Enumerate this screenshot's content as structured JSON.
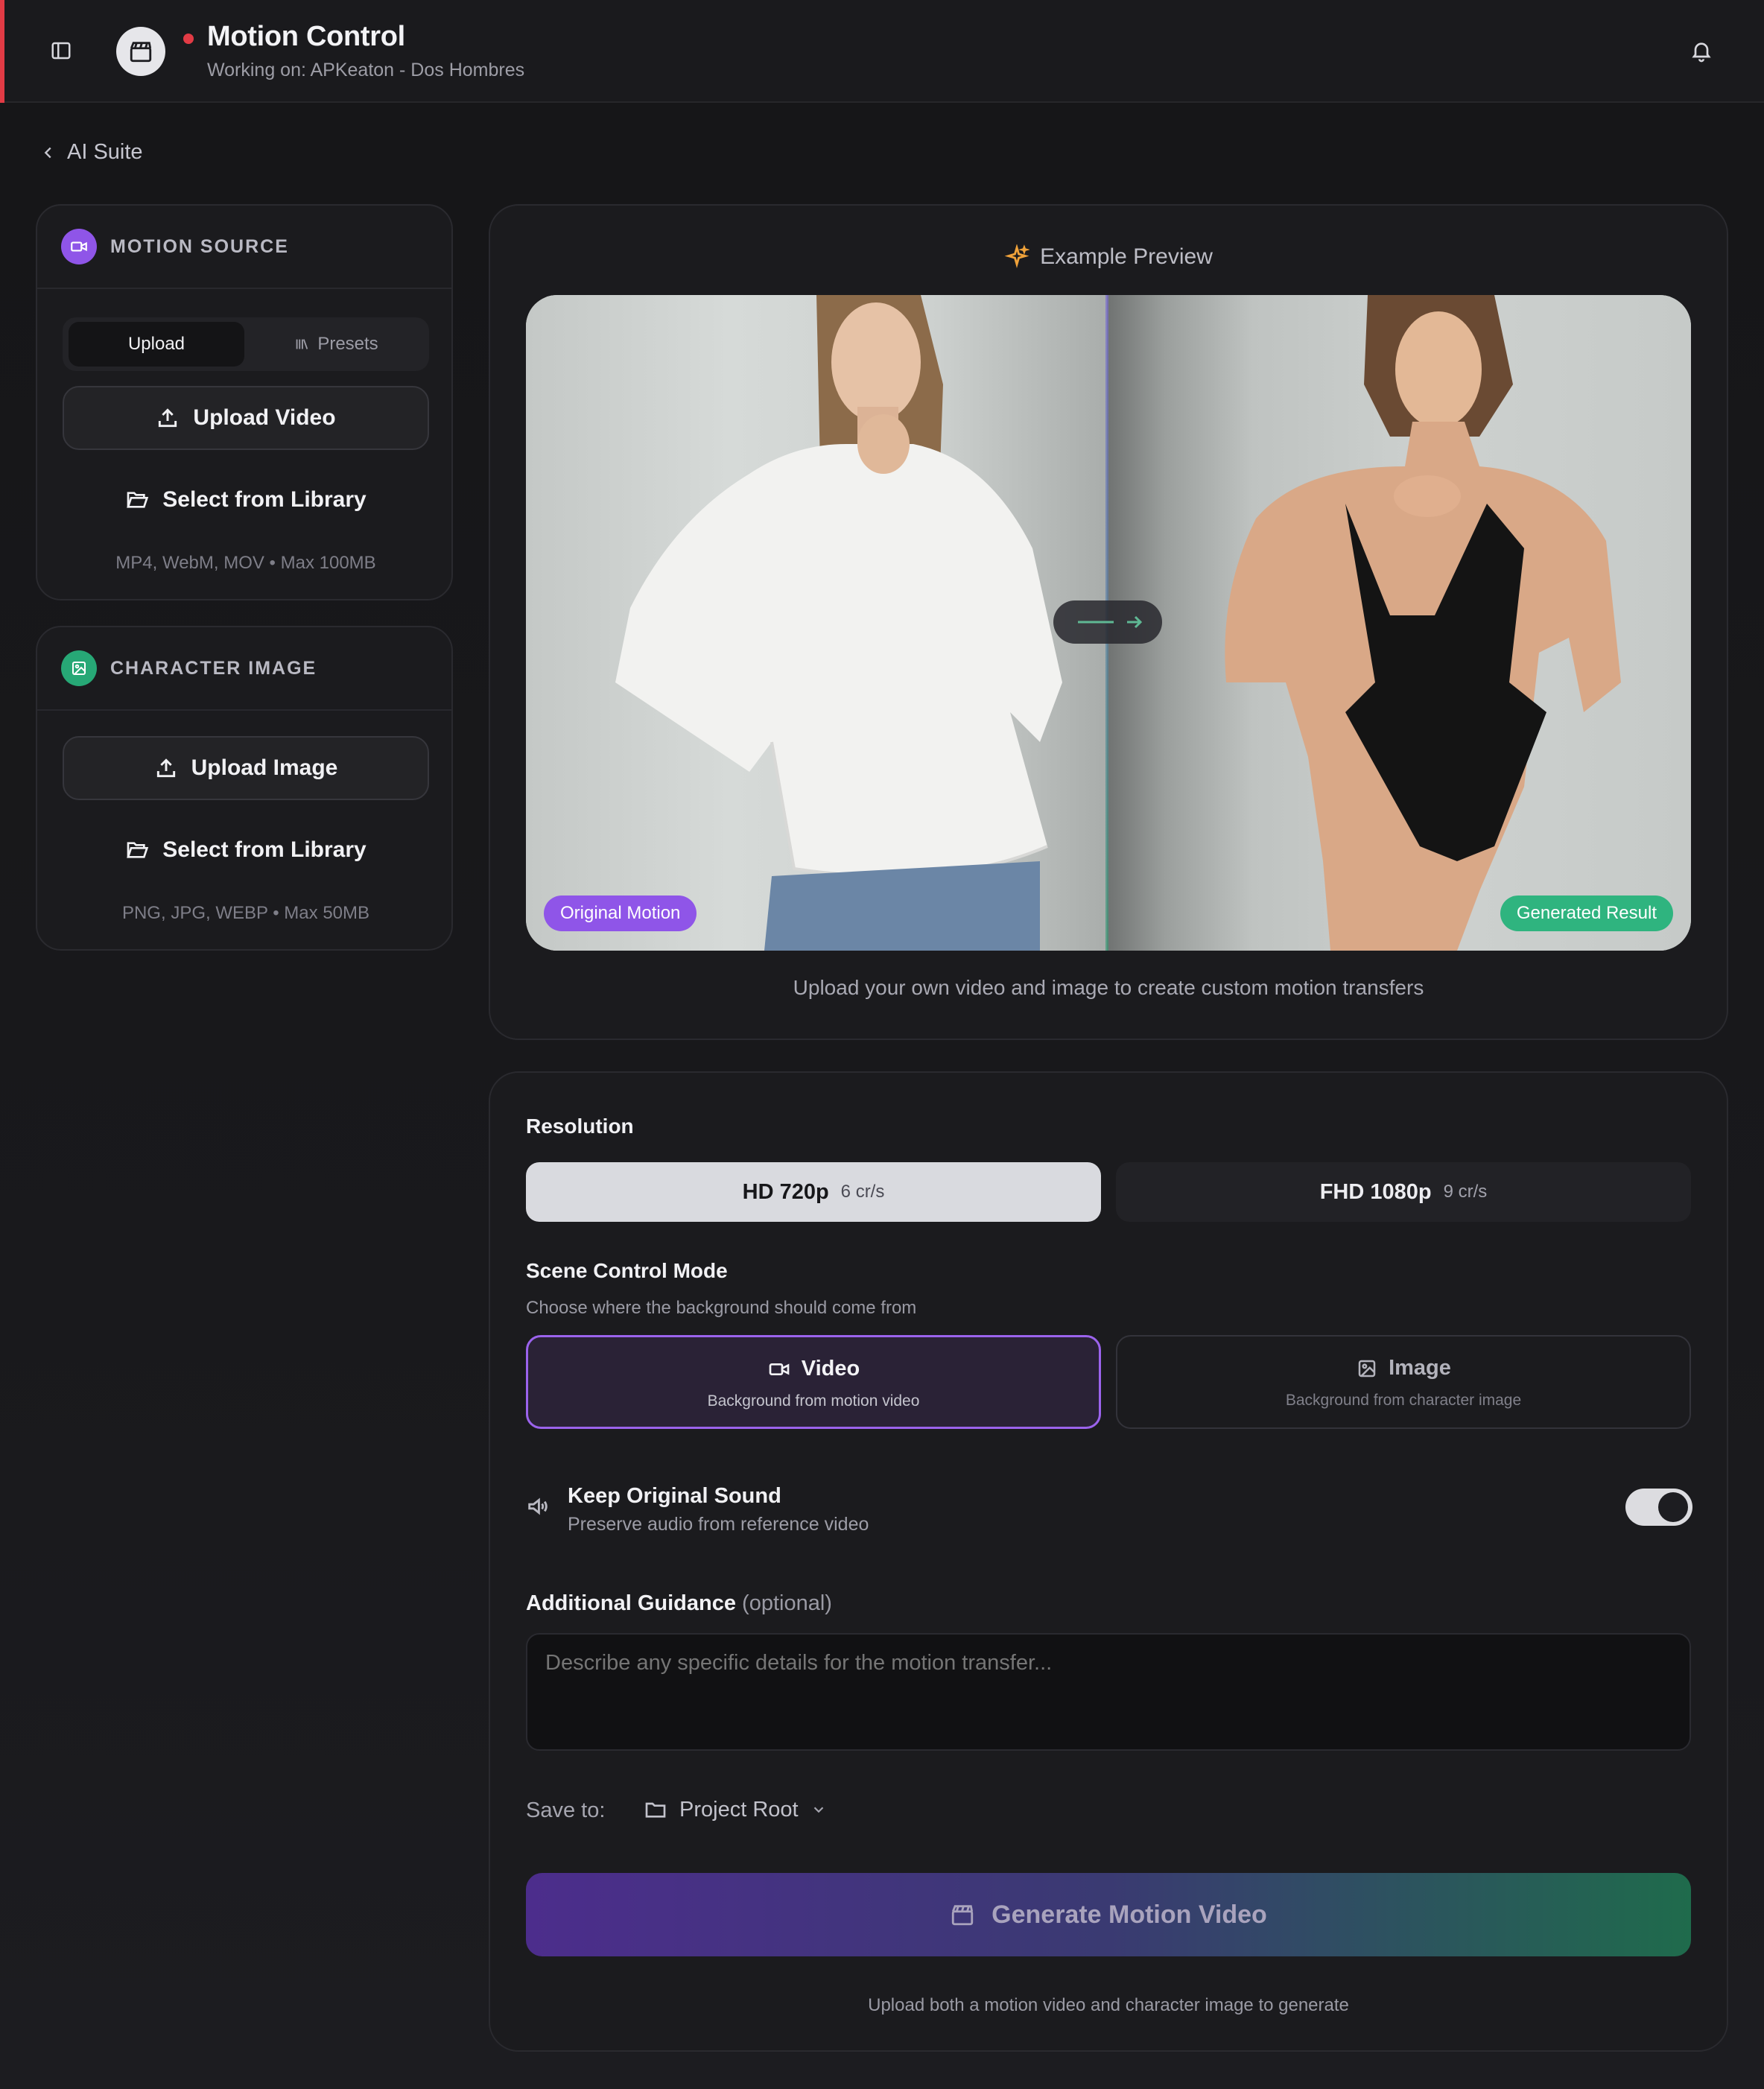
{
  "header": {
    "title": "Motion Control",
    "subtitle": "Working on: APKeaton - Dos Hombres"
  },
  "back_link": {
    "label": "AI Suite"
  },
  "motion_source": {
    "title": "MOTION SOURCE",
    "tabs": {
      "upload": "Upload",
      "presets": "Presets"
    },
    "upload_button": "Upload Video",
    "library_button": "Select from Library",
    "hint": "MP4, WebM, MOV • Max 100MB"
  },
  "character_image": {
    "title": "CHARACTER IMAGE",
    "upload_button": "Upload Image",
    "library_button": "Select from Library",
    "hint": "PNG, JPG, WEBP • Max 50MB"
  },
  "preview": {
    "title": "Example Preview",
    "tag_original": "Original Motion",
    "tag_generated": "Generated Result",
    "caption": "Upload your own video and image to create custom motion transfers"
  },
  "settings": {
    "resolution_label": "Resolution",
    "resolutions": [
      {
        "name": "HD 720p",
        "cost": "6 cr/s",
        "selected": true
      },
      {
        "name": "FHD 1080p",
        "cost": "9 cr/s",
        "selected": false
      }
    ],
    "scene_mode_label": "Scene Control Mode",
    "scene_mode_sub": "Choose where the background should come from",
    "modes": [
      {
        "name": "Video",
        "desc": "Background from motion video",
        "selected": true
      },
      {
        "name": "Image",
        "desc": "Background from character image",
        "selected": false
      }
    ],
    "sound_title": "Keep Original Sound",
    "sound_sub": "Preserve audio from reference video",
    "sound_enabled": true,
    "guidance_label": "Additional Guidance",
    "guidance_optional": "(optional)",
    "guidance_placeholder": "Describe any specific details for the motion transfer...",
    "save_label": "Save to:",
    "save_value": "Project Root",
    "generate_button": "Generate Motion Video",
    "generate_hint": "Upload both a motion video and character image to generate"
  },
  "colors": {
    "accent_purple": "#9b63ec",
    "accent_green": "#2fb47f",
    "live_red": "#e23b45"
  }
}
